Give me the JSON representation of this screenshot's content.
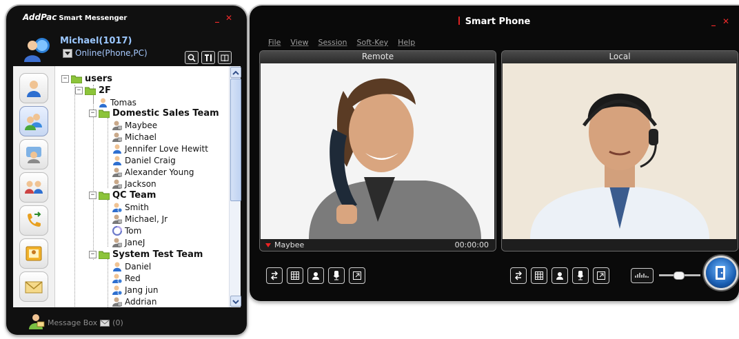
{
  "messenger": {
    "brand": "AddPac",
    "app_name": "Smart Messenger",
    "user": "Michael(1017)",
    "status": "Online(Phone,PC)",
    "tree": {
      "root": "users",
      "floor": "2F",
      "floor_member": "Tomas",
      "groups": [
        {
          "name": "Domestic Sales Team",
          "members": [
            "Maybee",
            "Michael",
            "Jennifer Love Hewitt",
            "Daniel Craig",
            "Alexander Young",
            "Jackson"
          ]
        },
        {
          "name": "QC Team",
          "members": [
            "Smith",
            "Michael, Jr",
            "Tom",
            "JaneJ"
          ]
        },
        {
          "name": "System Test Team",
          "members": [
            "Daniel",
            "Red",
            "Jang jun",
            "Addrian"
          ]
        }
      ]
    },
    "footer": {
      "message_box": "Message Box",
      "count": "(0)"
    }
  },
  "phone": {
    "title": "Smart Phone",
    "menu": [
      "File",
      "View",
      "Session",
      "Soft-Key",
      "Help"
    ],
    "remote": {
      "label": "Remote",
      "caller": "Maybee",
      "timer": "00:00:00"
    },
    "local": {
      "label": "Local"
    },
    "volume_level": 0.45
  },
  "colors": {
    "window_bg": "#0a0a0a",
    "user_name": "#9bc7ff",
    "close": "#ee2a2a"
  }
}
